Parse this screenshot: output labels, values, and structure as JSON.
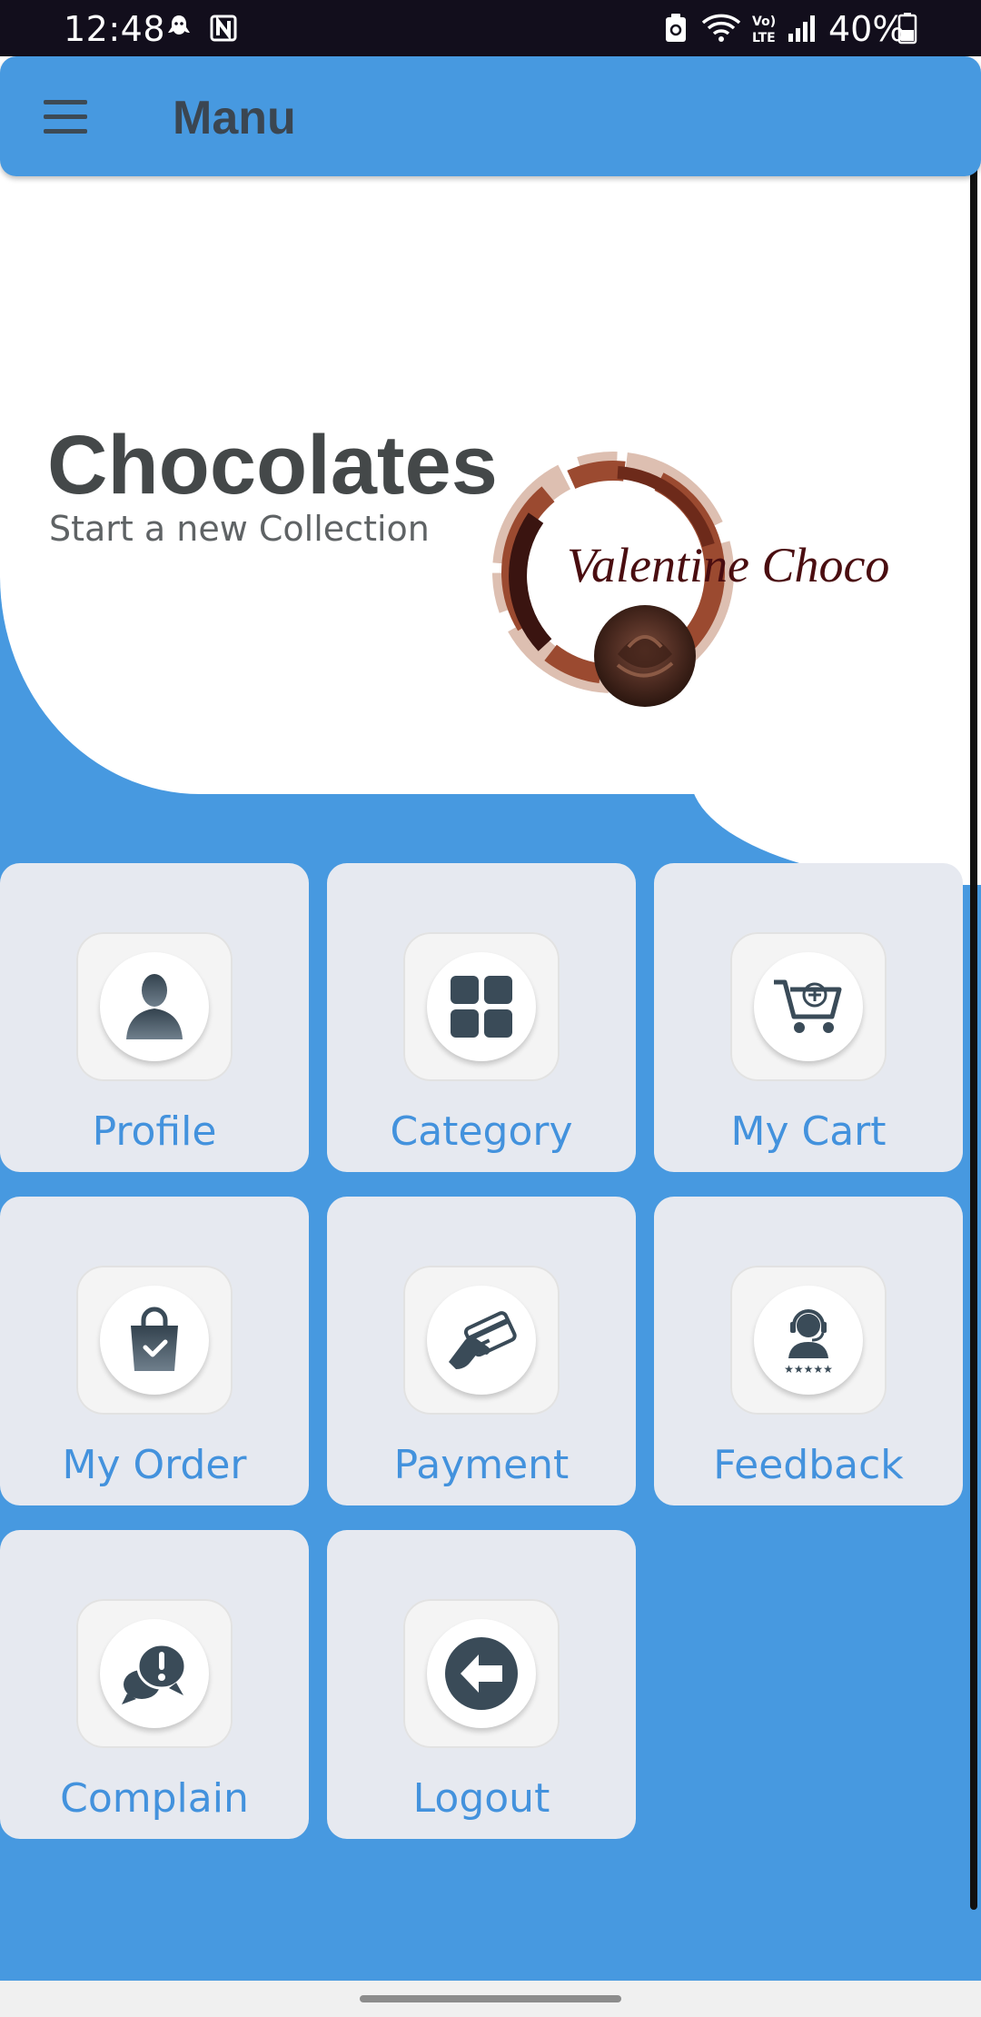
{
  "status_bar": {
    "time": "12:48",
    "battery": "40%",
    "icons": [
      "ghost-notification-icon",
      "n-app-icon",
      "recycle-icon",
      "wifi-icon",
      "volte-icon",
      "signal-icon",
      "battery-icon"
    ]
  },
  "toolbar": {
    "menu_icon": "hamburger-icon",
    "title": "Manu"
  },
  "hero": {
    "title": "Chocolates",
    "subtitle": "Start a new Collection",
    "logo_text": "Valentine Choco"
  },
  "menu": {
    "items": [
      {
        "label": "Profile",
        "icon": "person-icon"
      },
      {
        "label": "Category",
        "icon": "grid-icon"
      },
      {
        "label": "My Cart",
        "icon": "cart-icon"
      },
      {
        "label": "My Order",
        "icon": "shopping-bag-icon"
      },
      {
        "label": "Payment",
        "icon": "card-in-hand-icon"
      },
      {
        "label": "Feedback",
        "icon": "support-agent-icon"
      },
      {
        "label": "Complain",
        "icon": "chat-alert-icon"
      },
      {
        "label": "Logout",
        "icon": "logout-icon"
      }
    ]
  },
  "colors": {
    "primary": "#4799e0",
    "icon_dark": "#3a4b58",
    "tile_bg": "#e6e9f0",
    "label": "#4392dd"
  }
}
